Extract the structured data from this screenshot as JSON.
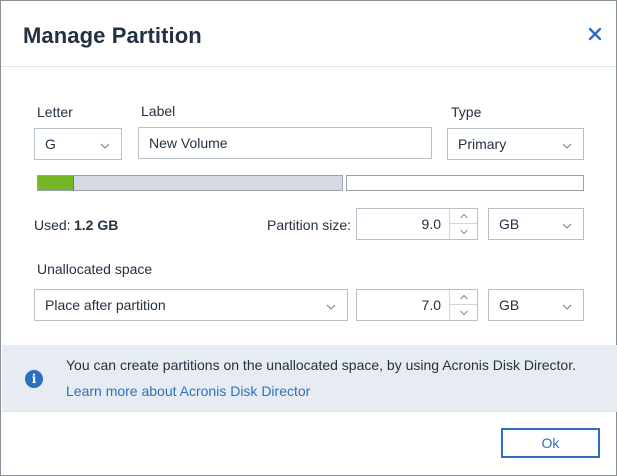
{
  "dialog": {
    "title": "Manage Partition",
    "close_icon": "close-icon"
  },
  "fields": {
    "letter_label": "Letter",
    "letter_value": "G",
    "label_label": "Label",
    "label_value": "New Volume",
    "type_label": "Type",
    "type_value": "Primary"
  },
  "usage": {
    "used_label": "Used:",
    "used_value": "1.2 GB",
    "used_fraction": 0.12,
    "partition_size_label": "Partition size:",
    "partition_size_value": "9.0",
    "partition_size_unit": "GB"
  },
  "unallocated": {
    "label": "Unallocated space",
    "placement_value": "Place after partition",
    "size_value": "7.0",
    "size_unit": "GB"
  },
  "info": {
    "icon": "info-icon",
    "text": "You can create partitions on the unallocated space, by using Acronis Disk Director.",
    "link": "Learn more about Acronis Disk Director"
  },
  "footer": {
    "ok_label": "Ok"
  },
  "colors": {
    "accent": "#2f6fbe",
    "used_bar": "#76b72a",
    "info_bg": "#e7ecf3"
  }
}
